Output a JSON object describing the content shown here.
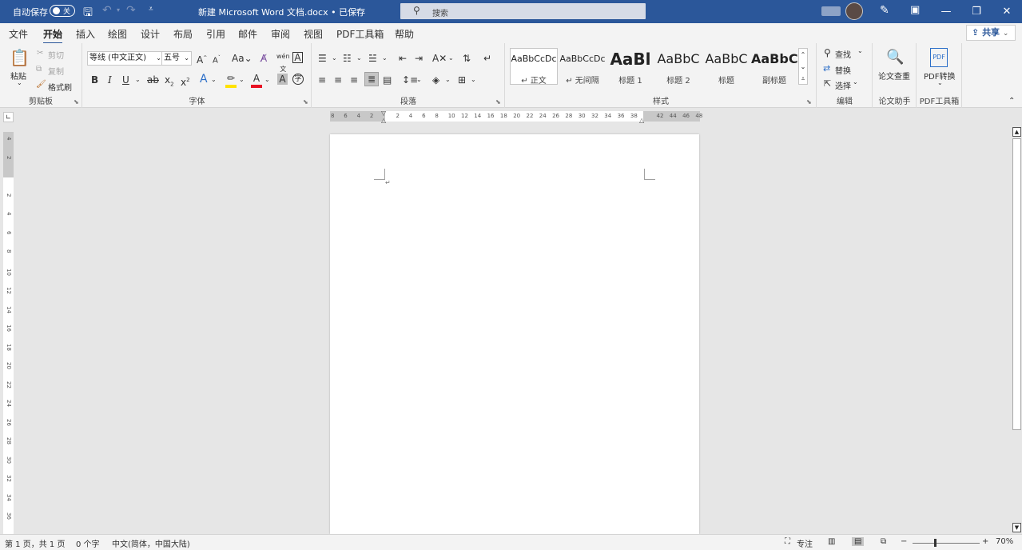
{
  "titlebar": {
    "autosave_label": "自动保存",
    "autosave_state": "关",
    "doc_title": "新建 Microsoft Word 文档.docx • 已保存",
    "search_placeholder": "搜索",
    "colors": {
      "titlebar": "#2b579a",
      "accent": "#2b579a"
    }
  },
  "tabs": [
    {
      "label": "文件"
    },
    {
      "label": "开始",
      "active": true
    },
    {
      "label": "插入"
    },
    {
      "label": "绘图"
    },
    {
      "label": "设计"
    },
    {
      "label": "布局"
    },
    {
      "label": "引用"
    },
    {
      "label": "邮件"
    },
    {
      "label": "审阅"
    },
    {
      "label": "视图"
    },
    {
      "label": "PDF工具箱"
    },
    {
      "label": "帮助"
    }
  ],
  "share_label": "共享",
  "ribbon": {
    "clipboard": {
      "paste": "粘贴",
      "cut": "剪切",
      "copy": "复制",
      "format_painter": "格式刷",
      "label": "剪贴板"
    },
    "font": {
      "font_name": "等线 (中文正文)",
      "font_size": "五号",
      "label": "字体"
    },
    "paragraph": {
      "label": "段落"
    },
    "styles": {
      "label": "样式",
      "items": [
        {
          "preview": "AaBbCcDc",
          "name": "↵ 正文"
        },
        {
          "preview": "AaBbCcDc",
          "name": "↵ 无间隔"
        },
        {
          "preview": "AaBl",
          "name": "标题 1"
        },
        {
          "preview": "AaBbC",
          "name": "标题 2"
        },
        {
          "preview": "AaBbC",
          "name": "标题"
        },
        {
          "preview": "AaBbC",
          "name": "副标题"
        }
      ]
    },
    "editing": {
      "find": "查找",
      "replace": "替换",
      "select": "选择",
      "label": "编辑"
    },
    "paper": {
      "check": "论文查重",
      "label": "论文助手"
    },
    "pdf": {
      "convert": "PDF转换",
      "label": "PDF工具箱"
    }
  },
  "ruler_numbers": [
    "8",
    "6",
    "4",
    "2",
    "",
    "2",
    "4",
    "6",
    "8",
    "10",
    "12",
    "14",
    "16",
    "18",
    "20",
    "22",
    "24",
    "26",
    "28",
    "30",
    "32",
    "34",
    "36",
    "38",
    "",
    "42",
    "44",
    "46",
    "48"
  ],
  "vruler_numbers": [
    "4",
    "2",
    "",
    "2",
    "4",
    "6",
    "8",
    "10",
    "12",
    "14",
    "16",
    "18",
    "20",
    "22",
    "24",
    "26",
    "28",
    "30",
    "32",
    "34",
    "36"
  ],
  "status": {
    "page": "第 1 页，共 1 页",
    "words": "0 个字",
    "language": "中文(简体，中国大陆)",
    "focus": "专注",
    "zoom": "70%"
  }
}
